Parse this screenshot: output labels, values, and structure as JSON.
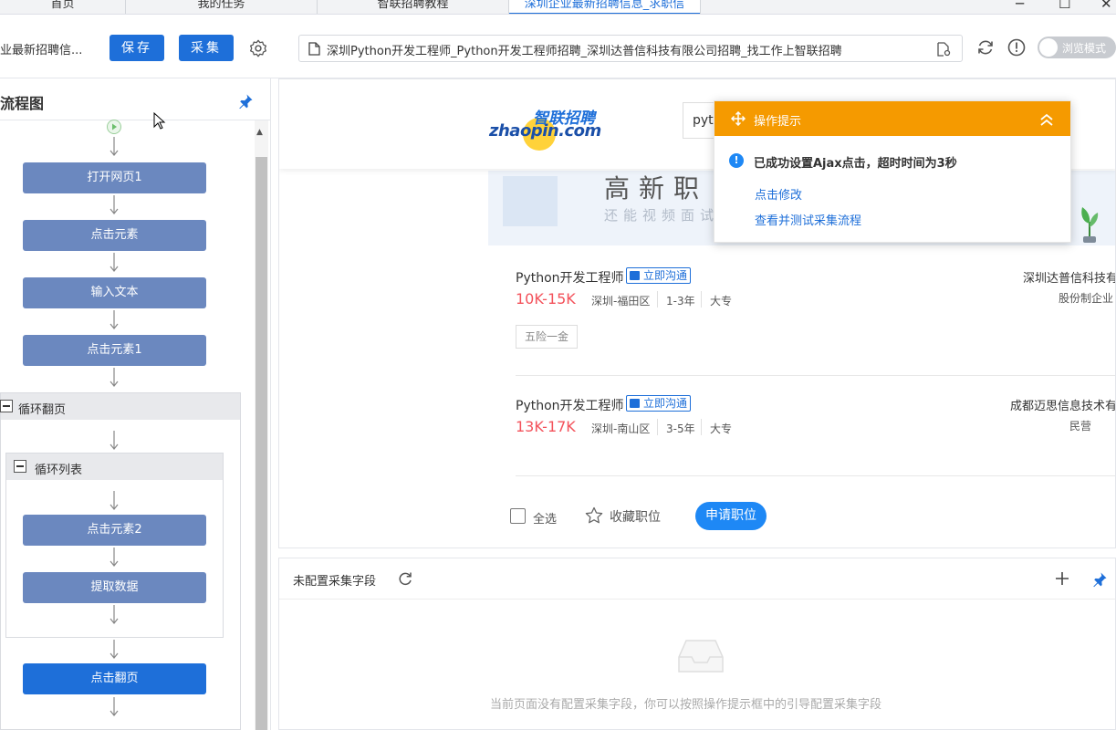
{
  "tabs": [
    {
      "label": "首页",
      "active": false
    },
    {
      "label": "我的任务",
      "active": false
    },
    {
      "label": "智联招聘教程",
      "active": false
    },
    {
      "label": "深圳企业最新招聘信息_求职信",
      "active": true
    }
  ],
  "toolbar": {
    "task_title": "业最新招聘信...",
    "save_label": "保存",
    "collect_label": "采集",
    "url": "深圳Python开发工程师_Python开发工程师招聘_深圳达普信科技有限公司招聘_找工作上智联招聘",
    "browse_mode_label": "浏览模式"
  },
  "flow": {
    "title": "流程图",
    "nodes": {
      "open_page": "打开网页1",
      "click_element": "点击元素",
      "input_text": "输入文本",
      "click_element1": "点击元素1",
      "click_element2": "点击元素2",
      "extract_data": "提取数据",
      "click_next_page": "点击翻页"
    },
    "loop_page_label": "循环翻页",
    "loop_list_label": "循环列表"
  },
  "site": {
    "logo_cn": "智联招聘",
    "logo_en": "zhaopin.com",
    "search_value": "pyth",
    "banner_big": "高新职",
    "banner_small": "还能视频面试"
  },
  "jobs": [
    {
      "title": "Python开发工程师",
      "chat_label": "立即沟通",
      "salary": "10K-15K",
      "location": "深圳-福田区",
      "experience": "1-3年",
      "education": "大专",
      "company": "深圳达普信科技有",
      "company_type": "股份制企业",
      "tags": [
        "五险一金"
      ]
    },
    {
      "title": "Python开发工程师",
      "chat_label": "立即沟通",
      "salary": "13K-17K",
      "location": "深圳-南山区",
      "experience": "3-5年",
      "education": "大专",
      "company": "成都迈思信息技术有",
      "company_type": "民营",
      "tags": []
    }
  ],
  "actions": {
    "select_all": "全选",
    "favorite": "收藏职位",
    "apply": "申请职位"
  },
  "hint": {
    "title": "操作提示",
    "message": "已成功设置Ajax点击，超时时间为3秒",
    "link_modify": "点击修改",
    "link_test": "查看并测试采集流程"
  },
  "fields_panel": {
    "title": "未配置采集字段",
    "empty_message": "当前页面没有配置采集字段，你可以按照操作提示框中的引导配置采集字段"
  },
  "colors": {
    "primary": "#1e6fd9",
    "node": "#6b88bf",
    "hint_header": "#f59a00",
    "salary": "#f3525b"
  }
}
